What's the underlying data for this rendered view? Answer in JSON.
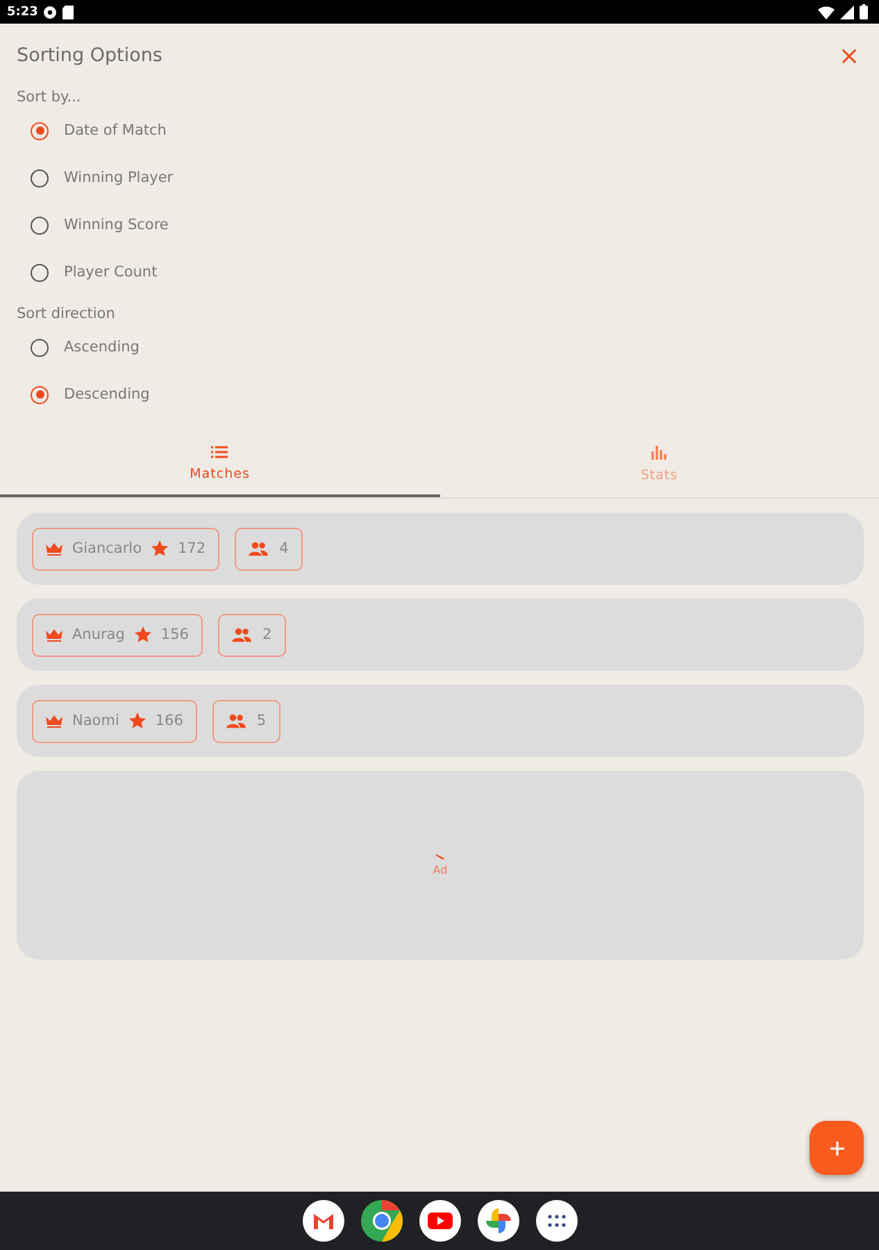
{
  "status_bar": {
    "time": "5:23"
  },
  "sheet": {
    "title": "Sorting Options",
    "sort_by": {
      "label": "Sort by...",
      "options": [
        {
          "label": "Date of Match",
          "selected": true
        },
        {
          "label": "Winning Player",
          "selected": false
        },
        {
          "label": "Winning Score",
          "selected": false
        },
        {
          "label": "Player Count",
          "selected": false
        }
      ]
    },
    "sort_direction": {
      "label": "Sort direction",
      "options": [
        {
          "label": "Ascending",
          "selected": false
        },
        {
          "label": "Descending",
          "selected": true
        }
      ]
    }
  },
  "tabs": [
    {
      "label": "Matches",
      "selected": true
    },
    {
      "label": "Stats",
      "selected": false
    }
  ],
  "matches": [
    {
      "winner": "Giancarlo",
      "score": "172",
      "players": "4"
    },
    {
      "winner": "Anurag",
      "score": "156",
      "players": "2"
    },
    {
      "winner": "Naomi",
      "score": "166",
      "players": "5"
    }
  ],
  "ad": {
    "label": "Ad"
  }
}
